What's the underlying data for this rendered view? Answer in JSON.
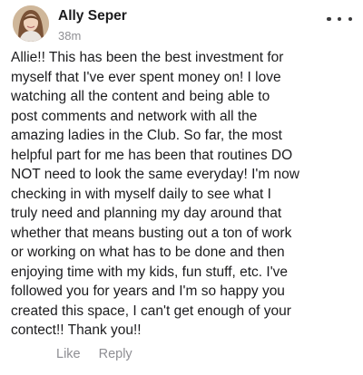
{
  "post": {
    "author": "Ally Seper",
    "timestamp": "38m",
    "more_icon": "more-horizontal-icon",
    "body": "Allie!! This has been the best investment for\nmyself that I've ever spent money on! I love\nwatching all the content and being able to\npost comments and network with all the\namazing ladies in the Club. So far, the most\nhelpful part for me has been that routines DO\nNOT need to look the same everyday! I'm now\nchecking in with myself daily to see what I\ntruly need and planning my day around that\nwhether that means busting out a ton of work\nor working on what has to be done and then\nenjoying time with my kids, fun stuff, etc. I've\nfollowed you for years and I'm so happy you\ncreated this space, I can't get enough of your\ncontect!! Thank you!!",
    "actions": {
      "like_label": "Like",
      "reply_label": "Reply"
    }
  },
  "colors": {
    "text": "#1c1c1e",
    "muted": "#8e8e93",
    "background": "#ffffff"
  }
}
